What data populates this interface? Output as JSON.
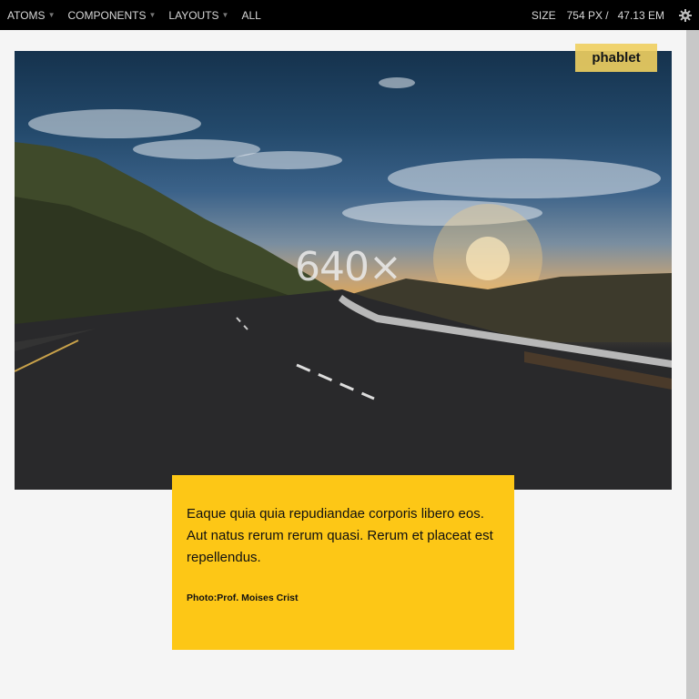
{
  "toolbar": {
    "nav": [
      {
        "label": "ATOMS",
        "has_menu": true
      },
      {
        "label": "COMPONENTS",
        "has_menu": true
      },
      {
        "label": "LAYOUTS",
        "has_menu": true
      },
      {
        "label": "ALL",
        "has_menu": false
      }
    ],
    "size_label": "SIZE",
    "size_px": "754 PX /",
    "size_em": "47.13 EM",
    "settings_icon": "gear-icon"
  },
  "badge": {
    "label": "phablet",
    "color": "#f0d060"
  },
  "hero": {
    "image_label": "640×",
    "scene": "mountain road at sunset"
  },
  "caption": {
    "body": "Eaque quia quia repudiandae corporis libero eos. Aut natus rerum rerum quasi. Rerum et placeat est repellendus.",
    "credit": "Photo:Prof. Moises Crist",
    "color": "#fdc716"
  }
}
